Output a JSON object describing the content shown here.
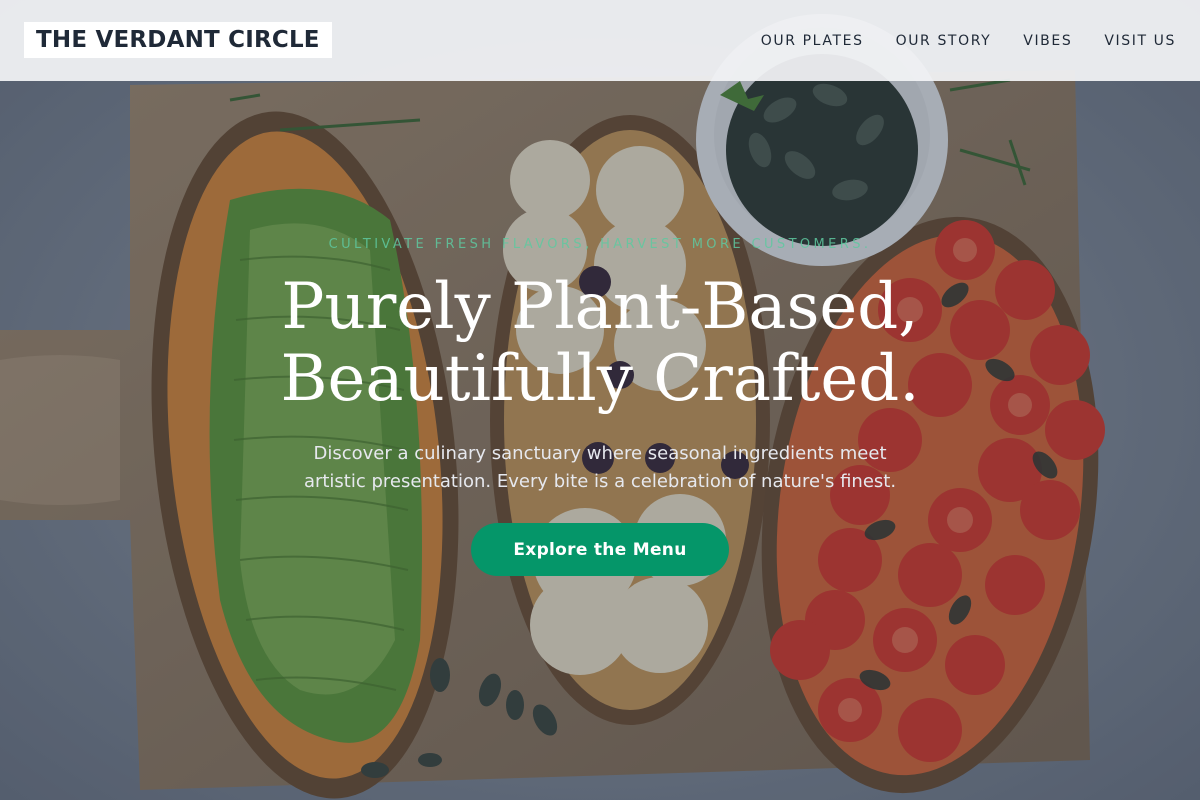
{
  "header": {
    "brand": "THE VERDANT CIRCLE",
    "nav": [
      {
        "label": "OUR PLATES"
      },
      {
        "label": "OUR STORY"
      },
      {
        "label": "VIBES"
      },
      {
        "label": "VISIT US"
      }
    ]
  },
  "hero": {
    "tagline": "CULTIVATE FRESH FLAVORS, HARVEST MORE CUSTOMERS.",
    "headline_line1": "Purely Plant-Based,",
    "headline_line2": "Beautifully Crafted.",
    "subtext_line1": "Discover a culinary sanctuary where seasonal ingredients meet",
    "subtext_line2": "artistic presentation. Every bite is a celebration of nature's finest.",
    "cta_label": "Explore the Menu"
  },
  "colors": {
    "accent": "#059669",
    "tagline": "#5fc9a0",
    "header_bg": "#f3f4f6",
    "text_dark": "#1f2937"
  }
}
